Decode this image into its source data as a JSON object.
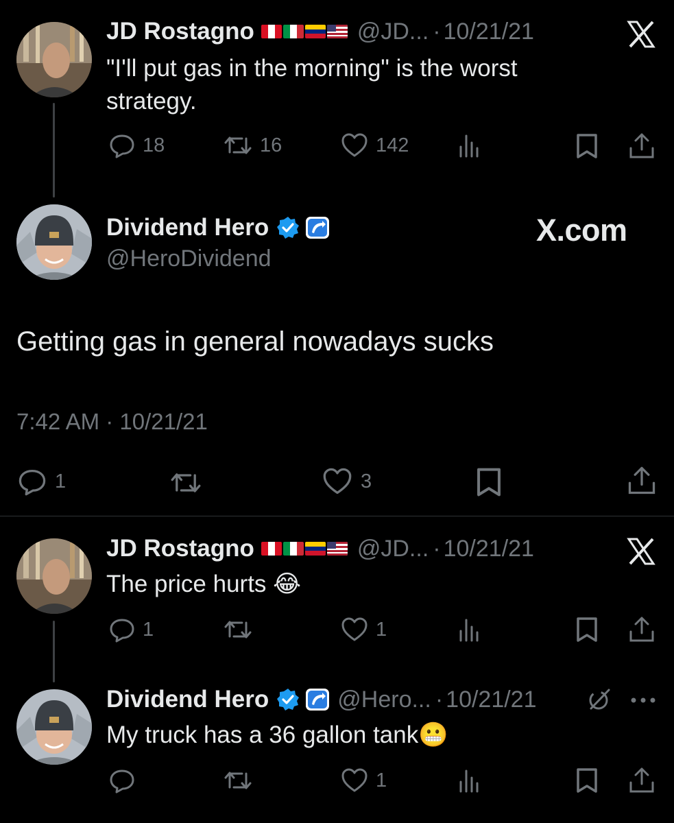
{
  "tweet1": {
    "name": "JD Rostagno",
    "handle": "@JD...",
    "dot": "·",
    "date": "10/21/21",
    "text_line1": "\"I'll put gas in the morning\" is the worst",
    "text_line2": "strategy.",
    "replies": "18",
    "retweets": "16",
    "likes": "142"
  },
  "main": {
    "name": "Dividend Hero",
    "handle": "@HeroDividend",
    "brand": "X.com",
    "text": "Getting gas in general nowadays sucks",
    "timestamp": "7:42 AM · 10/21/21",
    "replies": "1",
    "likes": "3"
  },
  "tweet3": {
    "name": "JD Rostagno",
    "handle": "@JD...",
    "dot": "·",
    "date": "10/21/21",
    "text": "The price hurts 😂",
    "replies": "1",
    "likes": "1"
  },
  "tweet4": {
    "name": "Dividend Hero",
    "handle": "@Hero...",
    "dot": "·",
    "date": "10/21/21",
    "text": "My truck has a 36 gallon tank😬",
    "likes": "1"
  },
  "colors": {
    "background": "#000000",
    "text": "#e7e9ea",
    "muted": "#71767b",
    "verified": "#1d9bf0"
  }
}
